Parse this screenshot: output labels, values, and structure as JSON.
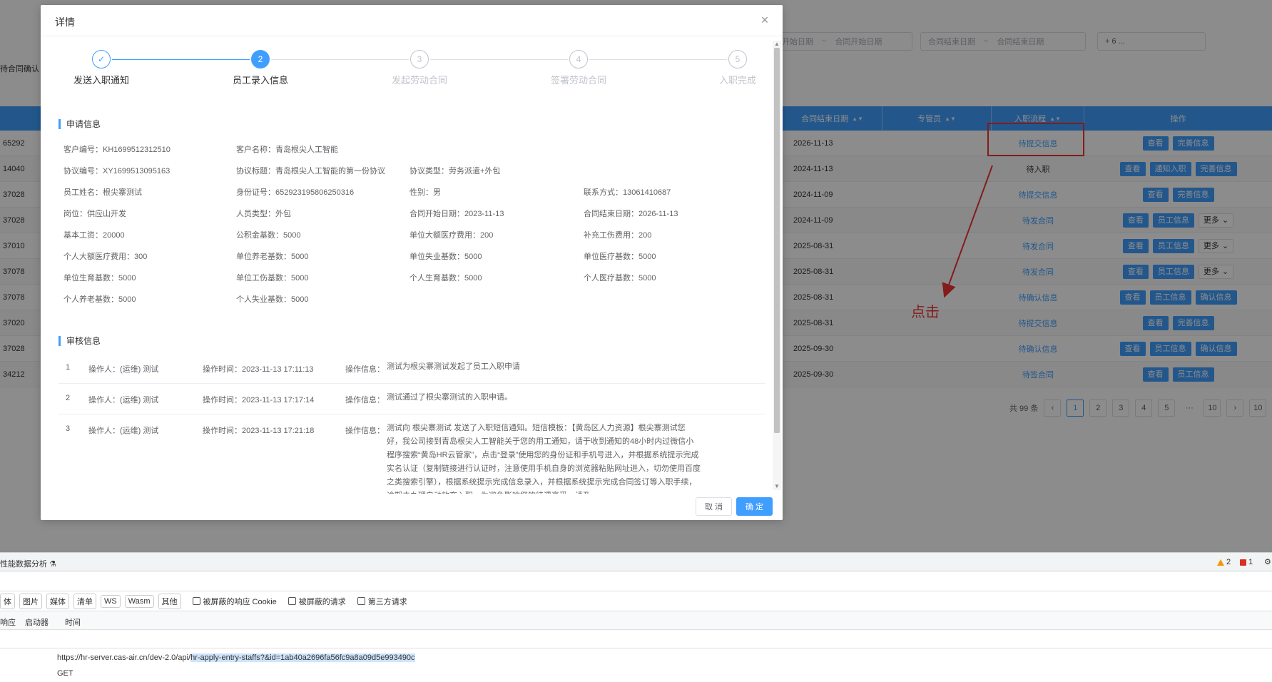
{
  "filters": {
    "contract_start_range": {
      "start": "开始日期",
      "separator": "~",
      "end": "合同开始日期"
    },
    "contract_end_range": {
      "start": "合同结束日期",
      "separator": "~",
      "end": "合同结束日期"
    },
    "more": "+ 6 ..."
  },
  "status_label": "待合同确认",
  "table": {
    "headers": {
      "contract_end": "合同结束日期",
      "manager": "专管员",
      "flow": "入职流程",
      "actions": "操作"
    },
    "rows": [
      {
        "id": "65292",
        "end_date": "2026-11-13",
        "flow": "待提交信息",
        "flow_plain": false,
        "buttons": [
          "查看",
          "完善信息"
        ],
        "more": false
      },
      {
        "id": "14040",
        "end_date": "2024-11-13",
        "flow": "待入职",
        "flow_plain": true,
        "buttons": [
          "查看",
          "通知入职",
          "完善信息"
        ],
        "more": false
      },
      {
        "id": "37028",
        "end_date": "2024-11-09",
        "flow": "待提交信息",
        "flow_plain": false,
        "buttons": [
          "查看",
          "完善信息"
        ],
        "more": false
      },
      {
        "id": "37028",
        "end_date": "2024-11-09",
        "flow": "待发合同",
        "flow_plain": false,
        "buttons": [
          "查看",
          "员工信息"
        ],
        "more": true
      },
      {
        "id": "37010",
        "end_date": "2025-08-31",
        "flow": "待发合同",
        "flow_plain": false,
        "buttons": [
          "查看",
          "员工信息"
        ],
        "more": true
      },
      {
        "id": "37078",
        "end_date": "2025-08-31",
        "flow": "待发合同",
        "flow_plain": false,
        "buttons": [
          "查看",
          "员工信息"
        ],
        "more": true
      },
      {
        "id": "37078",
        "end_date": "2025-08-31",
        "flow": "待确认信息",
        "flow_plain": false,
        "buttons": [
          "查看",
          "员工信息",
          "确认信息"
        ],
        "more": false
      },
      {
        "id": "37020",
        "end_date": "2025-08-31",
        "flow": "待提交信息",
        "flow_plain": false,
        "buttons": [
          "查看",
          "完善信息"
        ],
        "more": false
      },
      {
        "id": "37028",
        "end_date": "2025-09-30",
        "flow": "待确认信息",
        "flow_plain": false,
        "buttons": [
          "查看",
          "员工信息",
          "确认信息"
        ],
        "more": false
      },
      {
        "id": "34212",
        "end_date": "2025-09-30",
        "flow": "待签合同",
        "flow_plain": false,
        "buttons": [
          "查看",
          "员工信息"
        ],
        "more": false
      }
    ],
    "more_label": "更多"
  },
  "pagination": {
    "total": "共 99 条",
    "pages": [
      "1",
      "2",
      "3",
      "4",
      "5",
      "···",
      "10"
    ],
    "current": "1",
    "last": "10"
  },
  "annotation": {
    "click_label": "点击"
  },
  "modal": {
    "title": "详情",
    "close_glyph": "×",
    "steps": [
      {
        "label": "发送入职通知",
        "num": "✓",
        "state": "done"
      },
      {
        "label": "员工录入信息",
        "num": "2",
        "state": "active"
      },
      {
        "label": "发起劳动合同",
        "num": "3",
        "state": "wait"
      },
      {
        "label": "签署劳动合同",
        "num": "4",
        "state": "wait"
      },
      {
        "label": "入职完成",
        "num": "5",
        "state": "wait"
      }
    ],
    "apply_title": "申请信息",
    "apply_info": [
      [
        "客户编号：KH1699512312510",
        "客户名称：青岛根尖人工智能",
        "",
        ""
      ],
      [
        "协议编号：XY1699513095163",
        "协议标题：青岛根尖人工智能的第一份协议",
        "协议类型：劳务派遣+外包",
        ""
      ],
      [
        "员工姓名：根尖寨测试",
        "身份证号：652923195806250316",
        "性别：男",
        "联系方式：13061410687"
      ],
      [
        "岗位：供应山开发",
        "人员类型：外包",
        "合同开始日期：2023-11-13",
        "合同结束日期：2026-11-13"
      ],
      [
        "基本工资：20000",
        "公积金基数：5000",
        "单位大额医疗费用：200",
        "补充工伤费用：200"
      ],
      [
        "个人大额医疗费用：300",
        "单位养老基数：5000",
        "单位失业基数：5000",
        "单位医疗基数：5000"
      ],
      [
        "单位生育基数：5000",
        "单位工伤基数：5000",
        "个人生育基数：5000",
        "个人医疗基数：5000"
      ],
      [
        "个人养老基数：5000",
        "个人失业基数：5000",
        "",
        ""
      ]
    ],
    "audit_title": "审核信息",
    "audit_logs": [
      {
        "no": "1",
        "operator": "操作人：(运维) 测试",
        "time": "操作时间：2023-11-13 17:11:13",
        "info_label": "操作信息：",
        "info": "测试为根尖寨测试发起了员工入职申请"
      },
      {
        "no": "2",
        "operator": "操作人：(运维) 测试",
        "time": "操作时间：2023-11-13 17:17:14",
        "info_label": "操作信息：",
        "info": "测试通过了根尖寨测试的入职申请。"
      },
      {
        "no": "3",
        "operator": "操作人：(运维) 测试",
        "time": "操作时间：2023-11-13 17:21:18",
        "info_label": "操作信息：",
        "info": "测试向 根尖寨测试 发送了入职短信通知。短信模板：【黄岛区人力资源】根尖寨测试您好，我公司接到青岛根尖人工智能关于您的用工通知，请于收到通知的48小时内过微信小程序搜索“黄岛HR云管家”，点击“登录”使用您的身份证和手机号进入，并根据系统提示完成实名认证（复制链接进行认证时，注意使用手机自身的浏览器粘贴网址进入，切勿使用百度之类搜索引擎），根据系统提示完成信息录入，并根据系统提示完成合同签订等入职手续，逾期未办理自动放弃入职，为避免影响您的待遇享受，请及"
      }
    ],
    "cancel": "取 消",
    "ok": "确 定"
  },
  "devtools": {
    "perf_tab": "性能数据分析",
    "warn_count": "2",
    "error_count": "1",
    "filters": [
      "体",
      "图片",
      "媒体",
      "清单",
      "WS",
      "Wasm",
      "其他"
    ],
    "checkboxes": [
      "被屏蔽的响应 Cookie",
      "被屏蔽的请求",
      "第三方请求"
    ],
    "columns": [
      "响应",
      "启动器",
      "时间"
    ],
    "url_prefix": "https://hr-server.cas-air.cn/dev-2.0/api/",
    "url_highlight": "hr-apply-entry-staffs?&id=1ab40a2696fa56fc9a8a09d5e993490c",
    "method": "GET"
  }
}
